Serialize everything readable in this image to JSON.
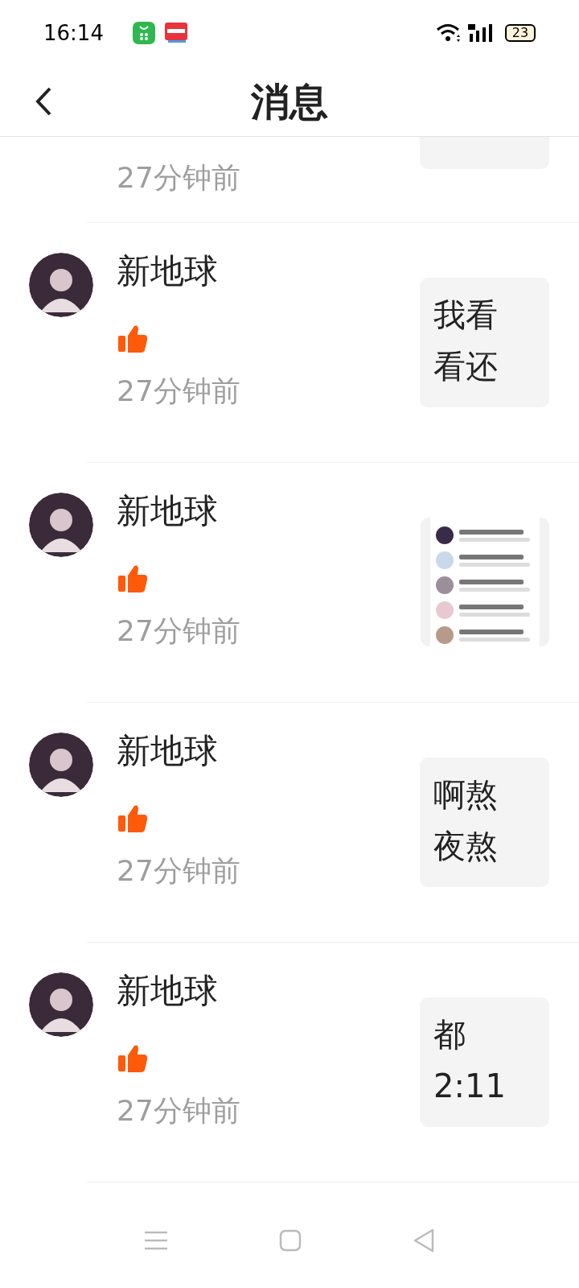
{
  "status_bar": {
    "time": "16:14",
    "battery": "23"
  },
  "header": {
    "title": "消息"
  },
  "messages": [
    {
      "kind": "partial",
      "time": "27分钟前"
    },
    {
      "kind": "text",
      "name": "新地球",
      "liked": true,
      "time": "27分钟前",
      "content": "我看看还"
    },
    {
      "kind": "picture",
      "name": "新地球",
      "liked": true,
      "time": "27分钟前"
    },
    {
      "kind": "text",
      "name": "新地球",
      "liked": true,
      "time": "27分钟前",
      "content": "啊熬夜熬"
    },
    {
      "kind": "text",
      "name": "新地球",
      "liked": true,
      "time": "27分钟前",
      "content": "都 2:11"
    }
  ]
}
